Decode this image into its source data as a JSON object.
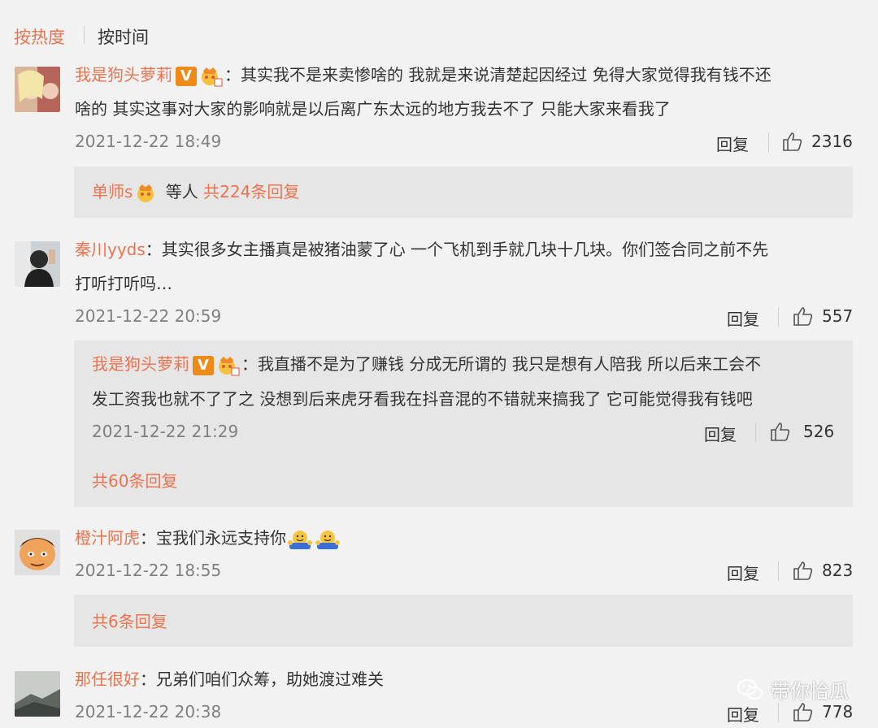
{
  "sort": {
    "hot_label": "按热度",
    "time_label": "按时间"
  },
  "comments": [
    {
      "user": "我是狗头萝莉",
      "text_line1": "其实我不是来卖惨啥的 我就是来说清楚起因经过 免得大家觉得我有钱不还",
      "text_line2": "啥的 其实这事对大家的影响就是以后离广东太远的地方我去不了 只能大家来看我了",
      "time": "2021-12-22 18:49",
      "reply_label": "回复",
      "likes": "2316",
      "sub_summary": {
        "user": "单师s",
        "middle": "等人",
        "link": "共224条回复"
      }
    },
    {
      "user": "秦川yyds",
      "text_line1": "其实很多女主播真是被猪油蒙了心 一个飞机到手就几块十几块。你们签合同之前不先",
      "text_line2": "打听打听吗…",
      "time": "2021-12-22 20:59",
      "reply_label": "回复",
      "likes": "557",
      "sub_reply": {
        "user": "我是狗头萝莉",
        "text_line1": "我直播不是为了赚钱 分成无所谓的 我只是想有人陪我 所以后来工会不",
        "text_line2": "发工资我也就不了了之 没想到后来虎牙看我在抖音混的不错就来搞我了 它可能觉得我有钱吧",
        "time": "2021-12-22 21:29",
        "reply_label": "回复",
        "likes": "526",
        "more_link": "共60条回复"
      }
    },
    {
      "user": "橙汁阿虎",
      "text_line1": "宝我们永远支持你",
      "time": "2021-12-22 18:55",
      "reply_label": "回复",
      "likes": "823",
      "more_link": "共6条回复"
    },
    {
      "user": "那任很好",
      "text_line1": "兄弟们咱们众筹，助她渡过难关",
      "time": "2021-12-22 20:38",
      "reply_label": "回复",
      "likes": "778"
    }
  ],
  "colon": "：",
  "badge_v": "V",
  "watermark": "带你恰瓜",
  "colors": {
    "accent": "#eb7350",
    "badge": "#ee8a18",
    "background": "#f2f2f2",
    "subbox": "#e6e6e6"
  },
  "icons": [
    "thumbs-up-icon",
    "vip-v-icon",
    "crown-icon",
    "hug-emoji-icon",
    "wechat-icon"
  ]
}
